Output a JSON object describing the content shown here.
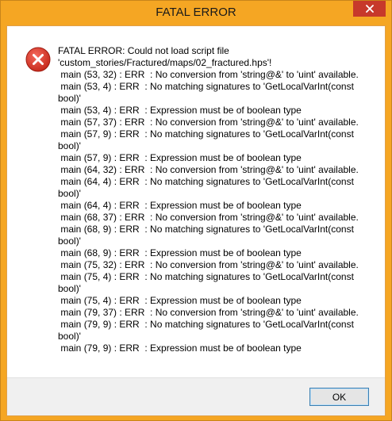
{
  "window": {
    "title": "FATAL ERROR",
    "title_bar_color": "#f5a623",
    "close_button_color": "#c7392b"
  },
  "dialog": {
    "icon": "error-icon",
    "message": "FATAL ERROR: Could not load script file\n'custom_stories/Fractured/maps/02_fractured.hps'!\n main (53, 32) : ERR  : No conversion from 'string@&' to 'uint' available.\n main (53, 4) : ERR  : No matching signatures to 'GetLocalVarInt(const bool)'\n main (53, 4) : ERR  : Expression must be of boolean type\n main (57, 37) : ERR  : No conversion from 'string@&' to 'uint' available.\n main (57, 9) : ERR  : No matching signatures to 'GetLocalVarInt(const bool)'\n main (57, 9) : ERR  : Expression must be of boolean type\n main (64, 32) : ERR  : No conversion from 'string@&' to 'uint' available.\n main (64, 4) : ERR  : No matching signatures to 'GetLocalVarInt(const bool)'\n main (64, 4) : ERR  : Expression must be of boolean type\n main (68, 37) : ERR  : No conversion from 'string@&' to 'uint' available.\n main (68, 9) : ERR  : No matching signatures to 'GetLocalVarInt(const bool)'\n main (68, 9) : ERR  : Expression must be of boolean type\n main (75, 32) : ERR  : No conversion from 'string@&' to 'uint' available.\n main (75, 4) : ERR  : No matching signatures to 'GetLocalVarInt(const bool)'\n main (75, 4) : ERR  : Expression must be of boolean type\n main (79, 37) : ERR  : No conversion from 'string@&' to 'uint' available.\n main (79, 9) : ERR  : No matching signatures to 'GetLocalVarInt(const bool)'\n main (79, 9) : ERR  : Expression must be of boolean type",
    "ok_label": "OK"
  }
}
